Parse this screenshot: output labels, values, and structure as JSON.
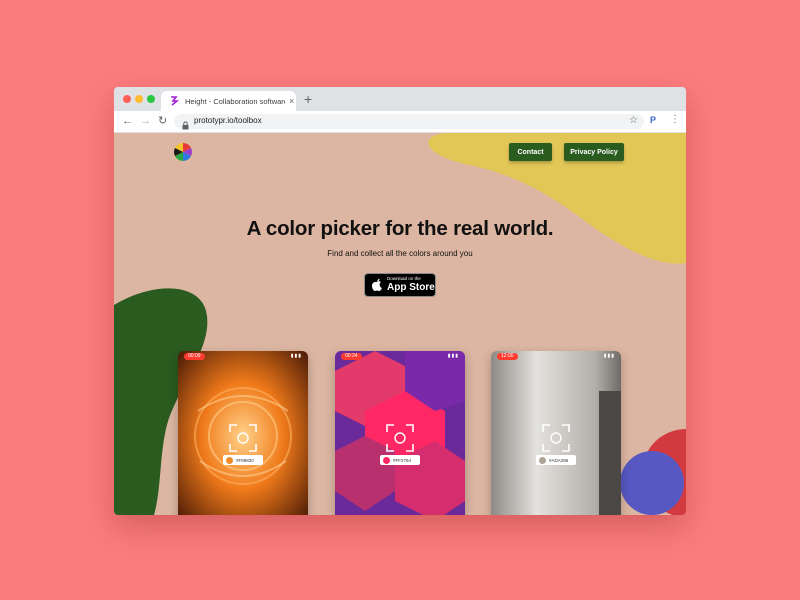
{
  "browser": {
    "tab_title": "Height - Collaboration software",
    "tab_close": "×",
    "new_tab": "+",
    "back": "←",
    "forward": "→",
    "reload": "↻",
    "url": "prototypr.io/toolbox",
    "star": "☆",
    "extension": "P",
    "menu": "⋮"
  },
  "nav": {
    "contact_label": "Contact",
    "privacy_label": "Privacy Policy"
  },
  "hero": {
    "headline": "A color picker for the real world.",
    "subheadline": "Find and collect all the colors around you"
  },
  "app_store": {
    "small_text": "Download on the",
    "big_text": "App Store"
  },
  "phones": [
    {
      "time": "00:09",
      "hex": "#F89820",
      "swatch": "#f08a26"
    },
    {
      "time": "00:24",
      "hex": "#FF2764",
      "swatch": "#ff2764"
    },
    {
      "time": "12:00",
      "hex": "#ADA296",
      "swatch": "#ada296"
    }
  ],
  "colors": {
    "background": "#fb7c7c",
    "page_bg": "#dcb6a2",
    "yellow_blob": "#e2c757",
    "green_blob": "#2a5b1f",
    "red_blob": "#d23a3f",
    "blue_blob": "#5858c2",
    "button_bg": "#2a5b1f"
  }
}
